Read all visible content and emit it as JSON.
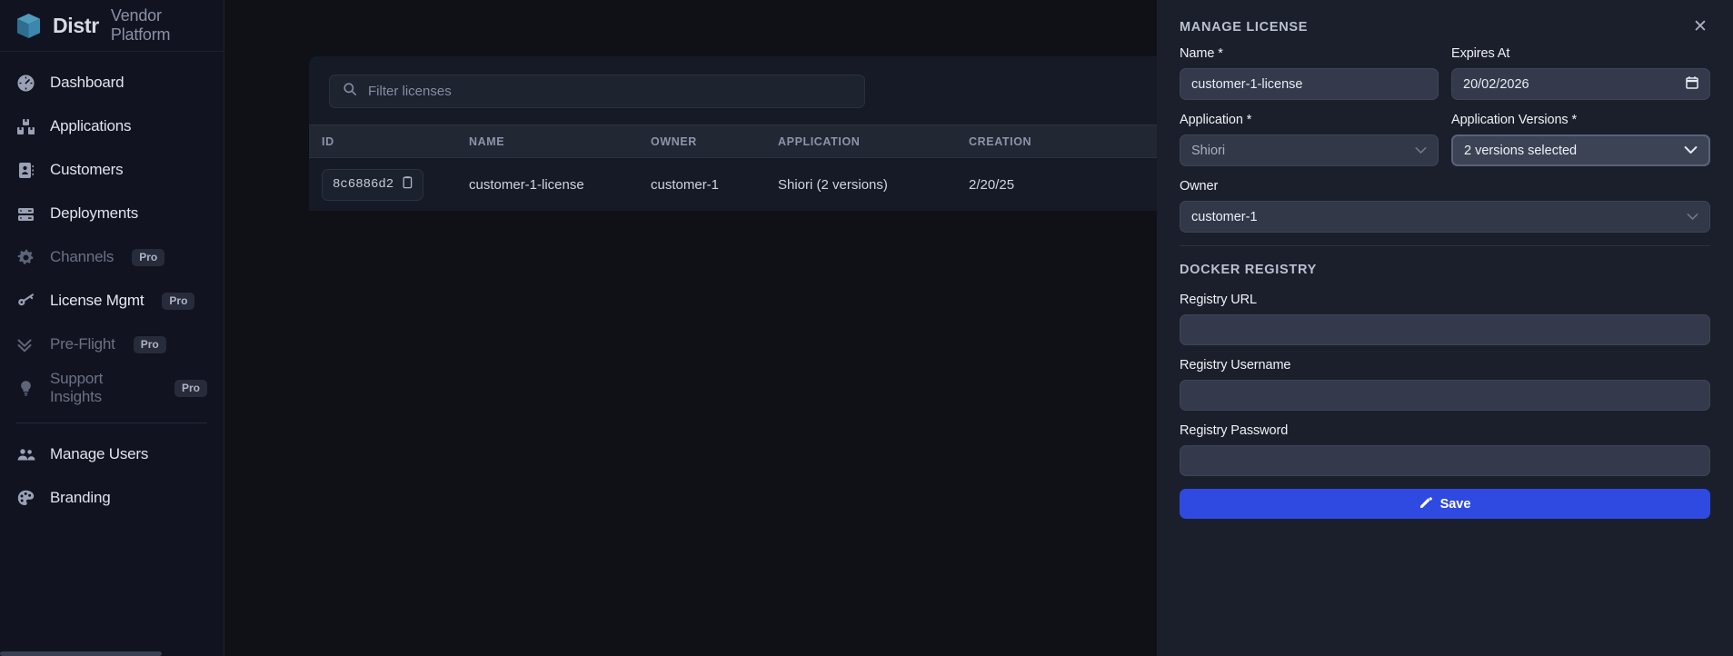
{
  "brand": {
    "name": "Distr",
    "subtitle": "Vendor Platform",
    "logo_icon": "cube-logo-icon",
    "accent": "#3b82a8"
  },
  "sidebar": {
    "items": [
      {
        "label": "Dashboard",
        "icon": "gauge-icon",
        "state": "enabled",
        "badge": ""
      },
      {
        "label": "Applications",
        "icon": "boxes-icon",
        "state": "enabled",
        "badge": ""
      },
      {
        "label": "Customers",
        "icon": "contact-id-icon",
        "state": "enabled",
        "badge": ""
      },
      {
        "label": "Deployments",
        "icon": "server-icon",
        "state": "enabled",
        "badge": ""
      },
      {
        "label": "Channels",
        "icon": "gear-icon",
        "state": "disabled",
        "badge": "Pro"
      },
      {
        "label": "License Mgmt",
        "icon": "key-icon",
        "state": "active",
        "badge": "Pro"
      },
      {
        "label": "Pre-Flight",
        "icon": "double-check-icon",
        "state": "disabled",
        "badge": "Pro"
      },
      {
        "label": "Support Insights",
        "icon": "lightbulb-icon",
        "state": "disabled",
        "badge": "Pro"
      }
    ],
    "footer_items": [
      {
        "label": "Manage Users",
        "icon": "users-icon",
        "state": "enabled",
        "badge": ""
      },
      {
        "label": "Branding",
        "icon": "palette-icon",
        "state": "enabled",
        "badge": ""
      }
    ]
  },
  "licenses": {
    "filter": {
      "placeholder": "Filter licenses",
      "value": "",
      "icon": "search-icon"
    },
    "columns": [
      "ID",
      "NAME",
      "OWNER",
      "APPLICATION",
      "CREATION"
    ],
    "rows": [
      {
        "id": "8c6886d2",
        "copy_icon": "copy-icon",
        "name": "customer-1-license",
        "owner": "customer-1",
        "application": "Shiori (2 versions)",
        "created": "2/20/25"
      }
    ]
  },
  "drawer": {
    "title": "MANAGE LICENSE",
    "close_icon": "close-icon",
    "fields": {
      "name": {
        "label": "Name *",
        "value": "customer-1-license",
        "placeholder": ""
      },
      "expires": {
        "label": "Expires At",
        "value": "20/02/2026",
        "icon": "calendar-icon"
      },
      "application": {
        "label": "Application *",
        "value": "Shiori",
        "icon": "chevron-down-icon"
      },
      "versions": {
        "label": "Application Versions *",
        "value": "2 versions selected",
        "icon": "chevron-down-icon"
      },
      "owner": {
        "label": "Owner",
        "value": "customer-1",
        "icon": "chevron-down-icon"
      }
    },
    "registry": {
      "section_title": "DOCKER REGISTRY",
      "url": {
        "label": "Registry URL",
        "value": "",
        "placeholder": ""
      },
      "username": {
        "label": "Registry Username",
        "value": "",
        "placeholder": ""
      },
      "password": {
        "label": "Registry Password",
        "value": "",
        "placeholder": ""
      }
    },
    "save": {
      "label": "Save",
      "icon": "pencil-icon",
      "color": "#2f4ae0"
    }
  }
}
